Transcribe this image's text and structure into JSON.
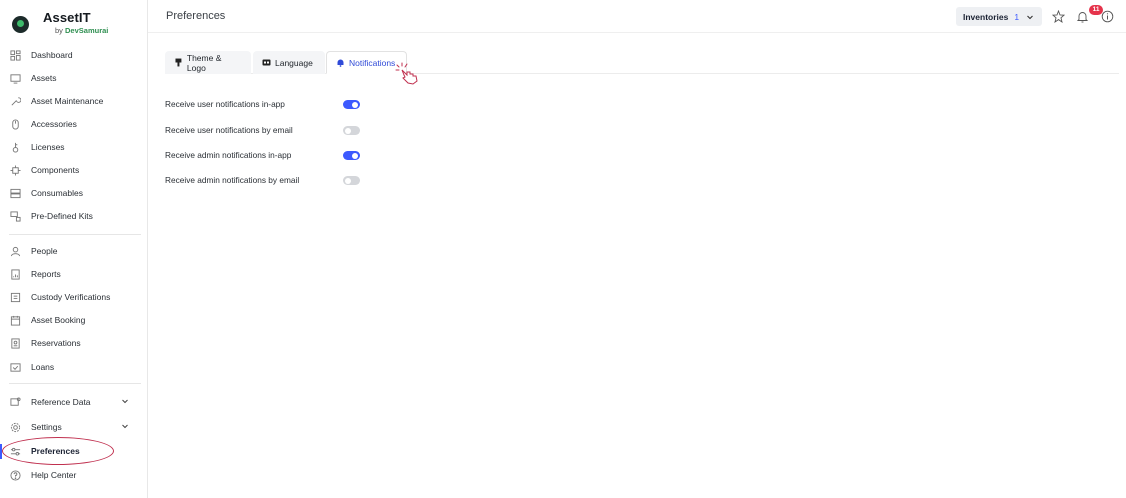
{
  "brand": {
    "name": "AssetIT",
    "by": "by",
    "author": "DevSamurai"
  },
  "header": {
    "title": "Preferences",
    "inventories_label": "Inventories",
    "inventories_count": "1",
    "notifications_badge": "11"
  },
  "sidebar": {
    "items": [
      {
        "label": "Dashboard",
        "icon": "dashboard-icon"
      },
      {
        "label": "Assets",
        "icon": "monitor-icon"
      },
      {
        "label": "Asset Maintenance",
        "icon": "wrench-icon"
      },
      {
        "label": "Accessories",
        "icon": "mouse-icon"
      },
      {
        "label": "Licenses",
        "icon": "key-icon"
      },
      {
        "label": "Components",
        "icon": "chip-icon"
      },
      {
        "label": "Consumables",
        "icon": "stack-icon"
      },
      {
        "label": "Pre-Defined Kits",
        "icon": "kit-icon"
      },
      {
        "label": "People",
        "icon": "person-icon"
      },
      {
        "label": "Reports",
        "icon": "report-icon"
      },
      {
        "label": "Custody Verifications",
        "icon": "clipboard-icon"
      },
      {
        "label": "Asset Booking",
        "icon": "calendar-icon"
      },
      {
        "label": "Reservations",
        "icon": "reservation-icon"
      },
      {
        "label": "Loans",
        "icon": "loan-icon"
      },
      {
        "label": "Reference Data",
        "icon": "reference-icon"
      },
      {
        "label": "Settings",
        "icon": "gear-icon"
      },
      {
        "label": "Preferences",
        "icon": "sliders-icon"
      },
      {
        "label": "Help Center",
        "icon": "help-icon"
      }
    ]
  },
  "tabs": [
    {
      "label": "Theme & Logo",
      "icon": "brush-icon"
    },
    {
      "label": "Language",
      "icon": "language-icon"
    },
    {
      "label": "Notifications",
      "icon": "bell-icon"
    }
  ],
  "settings": [
    {
      "label": "Receive user notifications in-app",
      "enabled": true
    },
    {
      "label": "Receive user notifications by email",
      "enabled": false
    },
    {
      "label": "Receive admin notifications in-app",
      "enabled": true
    },
    {
      "label": "Receive admin notifications by email",
      "enabled": false
    }
  ],
  "colors": {
    "accent": "#3d5afe",
    "badge": "#e5334b",
    "annotation": "#c0304f"
  }
}
